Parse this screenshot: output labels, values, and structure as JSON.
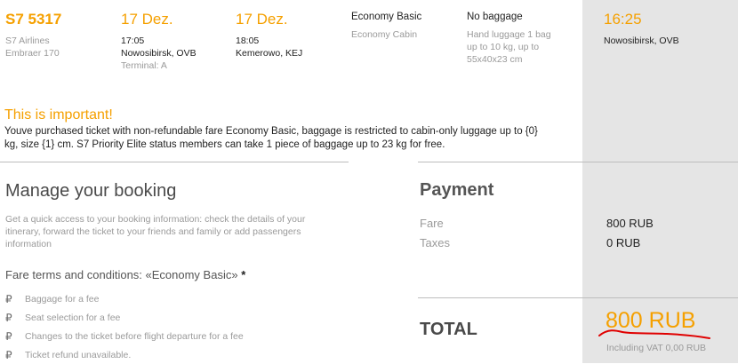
{
  "flight": {
    "code": "S7 5317",
    "airline": "S7 Airlines",
    "aircraft": "Embraer 170",
    "depart": {
      "date": "17 Dez.",
      "time": "17:05",
      "place": "Nowosibirsk, OVB",
      "terminal": "Terminal: A"
    },
    "arrive": {
      "date": "17 Dez.",
      "time": "18:05",
      "place": "Kemerowo, KEJ"
    },
    "fare": "Economy Basic",
    "cabin": "Economy Cabin",
    "baggage": "No baggage",
    "hand_luggage_line1": "Hand luggage 1 bag",
    "hand_luggage_line2": "up to 10 kg, up to",
    "hand_luggage_line3": "55x40x23 cm"
  },
  "right_panel": {
    "time": "16:25",
    "place": "Nowosibirsk, OVB"
  },
  "important": {
    "title": "This is important!",
    "line1": "Youve purchased ticket with non-refundable fare Economy Basic, baggage is restricted to cabin-only luggage up to {0}",
    "line2": "kg, size {1} cm. S7 Priority Elite status members can take 1 piece of baggage up to 23 kg for free."
  },
  "manage": {
    "title": "Manage your booking",
    "desc_line1": "Get a quick access to your booking information: check the details of your",
    "desc_line2": "itinerary, forward the ticket to your friends and family or add passengers",
    "desc_line3": "information",
    "fare_terms_prefix": "Fare terms and conditions: «Economy Basic»",
    "asterisk": "*",
    "terms": [
      "Baggage for a fee",
      "Seat selection for a fee",
      "Changes to the ticket before flight departure for a fee",
      "Ticket refund unavailable."
    ],
    "ruble_symbol": "₽"
  },
  "payment": {
    "title": "Payment",
    "fare_label": "Fare",
    "fare_value": "800 RUB",
    "taxes_label": "Taxes",
    "taxes_value": "0 RUB",
    "total_label": "TOTAL",
    "total_value": "800 RUB",
    "vat_note": "Including VAT 0,00 RUB"
  },
  "colors": {
    "accent": "#f5a000",
    "panel": "#e5e5e5",
    "annotation": "#e00000"
  }
}
